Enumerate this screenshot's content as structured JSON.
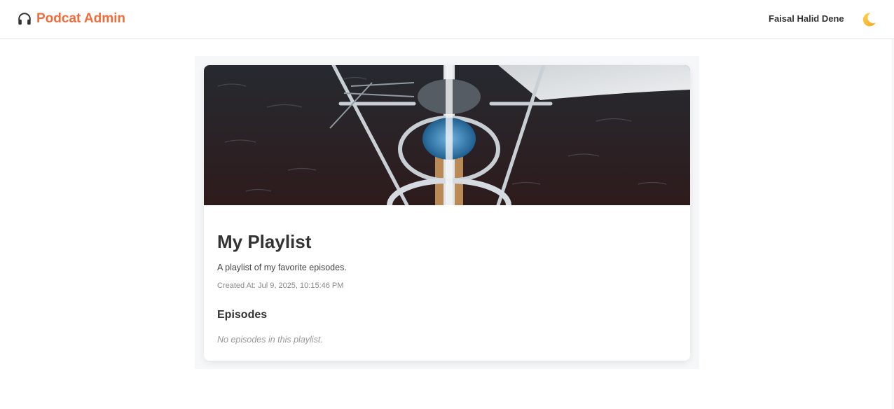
{
  "app": {
    "brand_name": "Podcat Admin",
    "brand_icon": "headphones-icon",
    "brand_color": "#f26b38"
  },
  "header": {
    "user_name": "Faisal Halid Dene",
    "theme_toggle_icon": "moon-icon"
  },
  "playlist": {
    "cover_image": "sailboat-bow-cover-image",
    "title": "My Playlist",
    "description": "A playlist of my favorite episodes.",
    "created_label": "Created At:",
    "created_value": "Jul 9, 2025, 10:15:46 PM",
    "episodes_heading": "Episodes",
    "empty_message": "No episodes in this playlist."
  }
}
